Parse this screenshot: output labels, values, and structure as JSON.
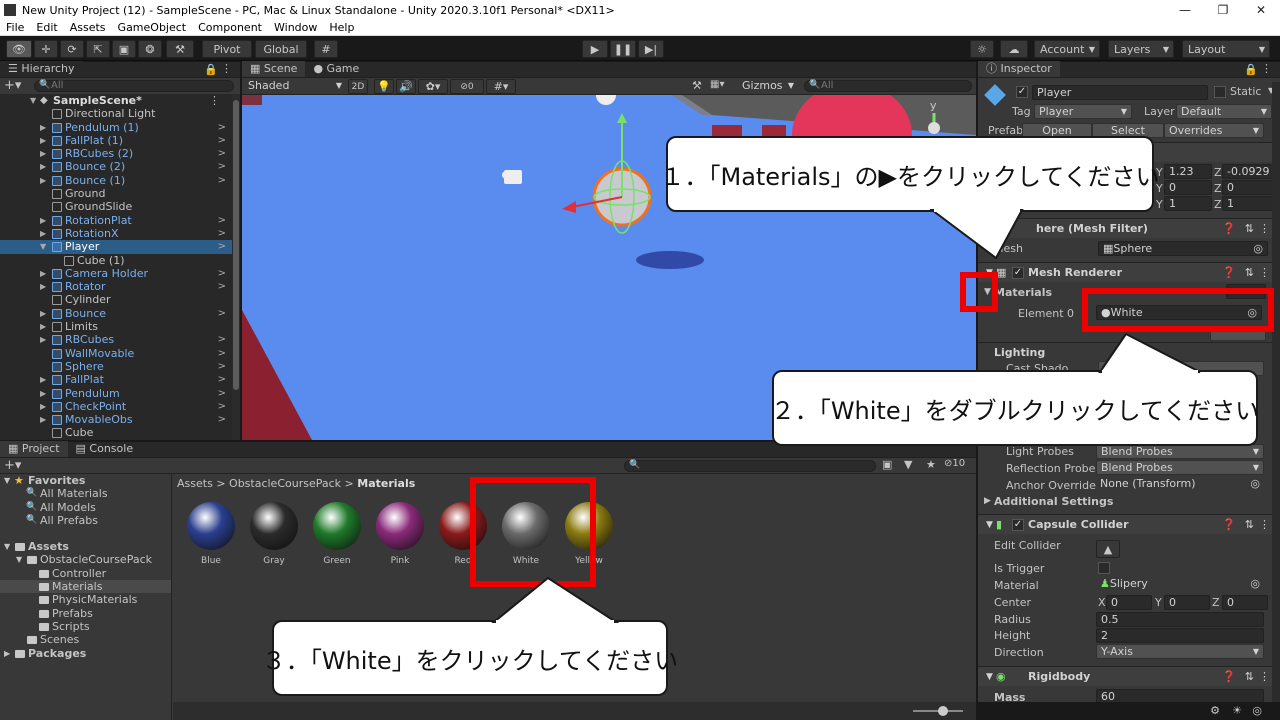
{
  "window": {
    "title": "New Unity Project (12) - SampleScene - PC, Mac & Linux Standalone - Unity 2020.3.10f1 Personal* <DX11>"
  },
  "menu": [
    "File",
    "Edit",
    "Assets",
    "GameObject",
    "Component",
    "Window",
    "Help"
  ],
  "toolbar": {
    "pivot_label": "Pivot",
    "global_label": "Global",
    "account_label": "Account",
    "layers_label": "Layers",
    "layout_label": "Layout"
  },
  "hierarchy": {
    "tab_label": "Hierarchy",
    "search_placeholder": "All",
    "scene_name": "SampleScene*",
    "items": [
      {
        "label": "Directional Light",
        "prefab": false,
        "fold": false,
        "indent": 1
      },
      {
        "label": "Pendulum (1)",
        "prefab": true,
        "fold": true,
        "indent": 1
      },
      {
        "label": "FallPlat (1)",
        "prefab": true,
        "fold": true,
        "indent": 1
      },
      {
        "label": "RBCubes (2)",
        "prefab": true,
        "fold": true,
        "indent": 1
      },
      {
        "label": "Bounce (2)",
        "prefab": true,
        "fold": true,
        "indent": 1
      },
      {
        "label": "Bounce (1)",
        "prefab": true,
        "fold": true,
        "indent": 1
      },
      {
        "label": "Ground",
        "prefab": false,
        "fold": false,
        "indent": 1
      },
      {
        "label": "GroundSlide",
        "prefab": false,
        "fold": false,
        "indent": 1
      },
      {
        "label": "RotationPlat",
        "prefab": true,
        "fold": true,
        "indent": 1
      },
      {
        "label": "RotationX",
        "prefab": true,
        "fold": true,
        "indent": 1
      },
      {
        "label": "Player",
        "prefab": true,
        "fold": true,
        "indent": 1,
        "selected": true
      },
      {
        "label": "Cube (1)",
        "prefab": false,
        "fold": false,
        "indent": 2
      },
      {
        "label": "Camera Holder",
        "prefab": true,
        "fold": true,
        "indent": 1
      },
      {
        "label": "Rotator",
        "prefab": true,
        "fold": true,
        "indent": 1
      },
      {
        "label": "Cylinder",
        "prefab": false,
        "fold": false,
        "indent": 1
      },
      {
        "label": "Bounce",
        "prefab": true,
        "fold": true,
        "indent": 1
      },
      {
        "label": "Limits",
        "prefab": false,
        "fold": true,
        "indent": 1
      },
      {
        "label": "RBCubes",
        "prefab": true,
        "fold": true,
        "indent": 1
      },
      {
        "label": "WallMovable",
        "prefab": true,
        "fold": false,
        "indent": 1
      },
      {
        "label": "Sphere",
        "prefab": true,
        "fold": false,
        "indent": 1
      },
      {
        "label": "FallPlat",
        "prefab": true,
        "fold": true,
        "indent": 1
      },
      {
        "label": "Pendulum",
        "prefab": true,
        "fold": true,
        "indent": 1
      },
      {
        "label": "CheckPoint",
        "prefab": true,
        "fold": true,
        "indent": 1
      },
      {
        "label": "MovableObs",
        "prefab": true,
        "fold": true,
        "indent": 1
      },
      {
        "label": "Cube",
        "prefab": false,
        "fold": false,
        "indent": 1
      }
    ]
  },
  "scene": {
    "tab_scene": "Scene",
    "tab_game": "Game",
    "shading_mode": "Shaded",
    "mode_2d": "2D",
    "hidden_count": "0",
    "gizmos_label": "Gizmos",
    "search_placeholder": "All"
  },
  "inspector": {
    "tab_label": "Inspector",
    "object_name": "Player",
    "static_label": "Static",
    "tag_label": "Tag",
    "tag_value": "Player",
    "layer_label": "Layer",
    "layer_value": "Default",
    "prefab_label": "Prefab",
    "prefab_open": "Open",
    "prefab_select": "Select",
    "prefab_overrides": "Overrides",
    "transform": {
      "pos_y": "1.23",
      "pos_z": "-0.0929",
      "rot_y": "0",
      "rot_z": "0",
      "scale_y": "1",
      "scale_z": "1",
      "y_label": "Y",
      "z_label": "Z"
    },
    "mesh_filter": {
      "title": "Sphere (Mesh Filter)",
      "title_visible": "here (Mesh Filter)",
      "mesh_label": "Mesh",
      "mesh_value": "Sphere"
    },
    "mesh_renderer": {
      "title": "Mesh Renderer",
      "materials_label": "Materials",
      "element0_label": "Element 0",
      "element0_value": "White"
    },
    "lighting": {
      "label": "Lighting",
      "cast_shadows_label": "Cast Shado"
    },
    "probes": {
      "light_probes_label": "Light Probes",
      "light_probes_value": "Blend Probes",
      "reflection_probes_label": "Reflection Probes",
      "reflection_probes_value": "Blend Probes",
      "anchor_override_label": "Anchor Override",
      "anchor_override_value": "None (Transform)"
    },
    "additional_settings_label": "Additional Settings",
    "capsule": {
      "title": "Capsule Collider",
      "edit_collider_label": "Edit Collider",
      "is_trigger_label": "Is Trigger",
      "material_label": "Material",
      "material_value": "Slipery",
      "center_label": "Center",
      "center_x": "0",
      "center_y": "0",
      "center_z": "0",
      "x_label": "X",
      "y_label": "Y",
      "z_label": "Z",
      "radius_label": "Radius",
      "radius_value": "0.5",
      "height_label": "Height",
      "height_value": "2",
      "direction_label": "Direction",
      "direction_value": "Y-Axis"
    },
    "rigidbody": {
      "title": "Rigidbody",
      "mass_label": "Mass",
      "mass_value": "60"
    }
  },
  "project": {
    "tab_project": "Project",
    "tab_console": "Console",
    "breadcrumb": [
      "Assets",
      "ObstacleCoursePack",
      "Materials"
    ],
    "hidden_count": "10",
    "favorites_label": "Favorites",
    "favorites": [
      "All Materials",
      "All Models",
      "All Prefabs"
    ],
    "assets_label": "Assets",
    "pack_label": "ObstacleCoursePack",
    "pack_folders": [
      "Controller",
      "Materials",
      "PhysicMaterials",
      "Prefabs",
      "Scripts"
    ],
    "scenes_label": "Scenes",
    "packages_label": "Packages",
    "materials": [
      {
        "name": "Blue",
        "color": "#2a3f8f"
      },
      {
        "name": "Gray",
        "color": "#2b2b2b"
      },
      {
        "name": "Green",
        "color": "#1f7a2a"
      },
      {
        "name": "Pink",
        "color": "#8a2a7a"
      },
      {
        "name": "Red",
        "color": "#8a1a1a"
      },
      {
        "name": "White",
        "color": "#6a6a6a"
      },
      {
        "name": "Yellow",
        "color": "#8a7a10"
      }
    ]
  },
  "callouts": {
    "step1": "１．「Materials」の▶をクリックしてください",
    "step2": "２．「White」をダブルクリックしてください",
    "step3": "３．「White」をクリックしてください"
  },
  "colors": {
    "selection": "#2c5d87",
    "prefab_text": "#7bb0ee",
    "highlight_red": "#ee0000",
    "ground_blue": "#5a8bef"
  }
}
